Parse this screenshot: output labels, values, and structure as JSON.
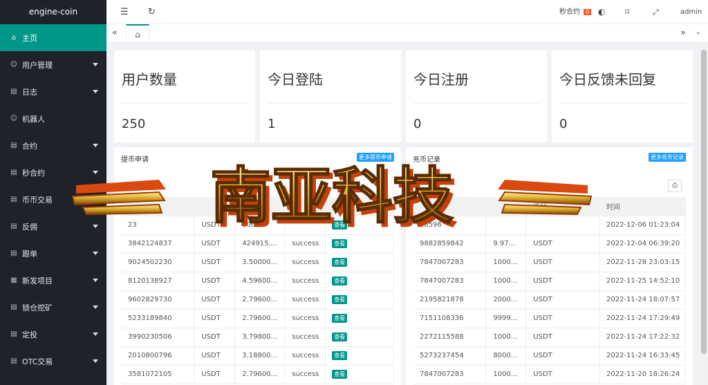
{
  "sidebar": {
    "logo": "engine-coin",
    "items": [
      {
        "label": "主页",
        "icon": "home-icon",
        "glyph": "⌂"
      },
      {
        "label": "用户管理",
        "icon": "user-icon",
        "glyph": "☺"
      },
      {
        "label": "日志",
        "icon": "doc-icon",
        "glyph": "▤"
      },
      {
        "label": "机器人",
        "icon": "user-icon",
        "glyph": "☺"
      },
      {
        "label": "合约",
        "icon": "doc-icon",
        "glyph": "▤"
      },
      {
        "label": "秒合约",
        "icon": "doc-icon",
        "glyph": "▤"
      },
      {
        "label": "币币交易",
        "icon": "doc-icon",
        "glyph": "▤"
      },
      {
        "label": "反佣",
        "icon": "doc-icon",
        "glyph": "▤"
      },
      {
        "label": "跟单",
        "icon": "doc-icon",
        "glyph": "▤"
      },
      {
        "label": "新发项目",
        "icon": "grid-icon",
        "glyph": "▦"
      },
      {
        "label": "锁仓挖矿",
        "icon": "doc-icon",
        "glyph": "▤"
      },
      {
        "label": "定投",
        "icon": "doc-icon",
        "glyph": "▤"
      },
      {
        "label": "OTC交易",
        "icon": "doc-icon",
        "glyph": "▤"
      }
    ]
  },
  "header": {
    "seconds_contract": "秒合约",
    "badge": "0",
    "user": "admin"
  },
  "stats": [
    {
      "title": "用户数量",
      "value": "250"
    },
    {
      "title": "今日登陆",
      "value": "1"
    },
    {
      "title": "今日注册",
      "value": "0"
    },
    {
      "title": "今日反馈未回复",
      "value": "0"
    }
  ],
  "withdraw": {
    "title": "提币申请",
    "more": "更多提币申请",
    "headers": [
      "",
      "",
      "数量",
      "",
      "提"
    ],
    "view_label": "查看",
    "rows": [
      [
        "23",
        "USDT",
        "800...",
        "",
        "查看"
      ],
      [
        "3842124837",
        "USDT",
        "424915....",
        "success",
        "查看"
      ],
      [
        "9024502230",
        "USDT",
        "3.50000...",
        "success",
        "查看"
      ],
      [
        "8120138927",
        "USDT",
        "4.59600...",
        "success",
        "查看"
      ],
      [
        "9602829730",
        "USDT",
        "2.79600...",
        "success",
        "查看"
      ],
      [
        "5233189840",
        "USDT",
        "2.79600...",
        "success",
        "查看"
      ],
      [
        "3990230506",
        "USDT",
        "3.79800...",
        "success",
        "查看"
      ],
      [
        "2010800796",
        "USDT",
        "3.18800...",
        "success",
        "查看"
      ],
      [
        "3581072105",
        "USDT",
        "2.79600...",
        "success",
        "查看"
      ]
    ]
  },
  "recharge": {
    "title": "充币记录",
    "more": "更多充币记录",
    "headers": [
      "",
      "",
      "币种",
      "时间"
    ],
    "rows": [
      [
        "28596",
        "",
        "",
        "2022-12-06 01:23:04"
      ],
      [
        "9882859842",
        "9.97...",
        "USDT",
        "2022-12-04 06:39:20"
      ],
      [
        "7847007283",
        "1000...",
        "USDT",
        "2022-11-28 23:03:15"
      ],
      [
        "7847007283",
        "1000...",
        "USDT",
        "2022-11-25 14:52:10"
      ],
      [
        "2195821878",
        "2000...",
        "USDT",
        "2022-11-24 18:07:57"
      ],
      [
        "7151108336",
        "9999...",
        "USDT",
        "2022-11-24 17:29:49"
      ],
      [
        "2272115588",
        "1000...",
        "USDT",
        "2022-11-24 17:22:32"
      ],
      [
        "5273237454",
        "8000...",
        "USDT",
        "2022-11-24 16:33:45"
      ],
      [
        "7847007283",
        "1000...",
        "USDT",
        "2022-11-20 18:26:24"
      ]
    ]
  },
  "watermark": "南亚科技"
}
